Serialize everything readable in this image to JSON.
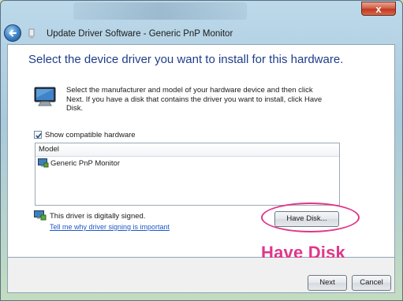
{
  "window": {
    "title": "Update Driver Software - Generic PnP Monitor",
    "close_label": "x"
  },
  "main": {
    "heading": "Select the device driver you want to install for this hardware.",
    "description": "Select the manufacturer and model of your hardware device and then click Next. If you have a disk that contains the driver you want to install, click Have Disk.",
    "show_compatible": {
      "label": "Show compatible hardware",
      "checked": true
    },
    "model_list": {
      "header": "Model",
      "items": [
        "Generic PnP Monitor"
      ]
    },
    "signature": {
      "text": "This driver is digitally signed.",
      "link": "Tell me why driver signing is important"
    },
    "have_disk_label": "Have Disk...",
    "annotation": "Have Disk"
  },
  "footer": {
    "next_label": "Next",
    "cancel_label": "Cancel"
  },
  "colors": {
    "heading": "#1e3d8a",
    "link": "#1f58c8",
    "annotation": "#e0368a"
  }
}
